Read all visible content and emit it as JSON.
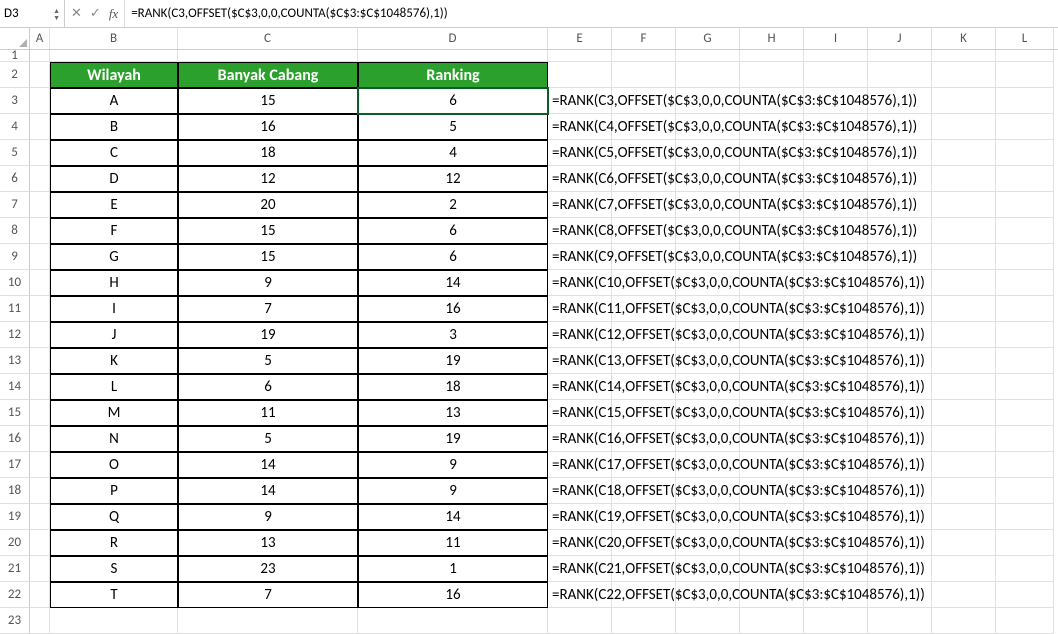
{
  "cell_reference": "D3",
  "formula": "=RANK(C3,OFFSET($C$3,0,0,COUNTA($C$3:$C$1048576),1))",
  "columns": [
    "A",
    "B",
    "C",
    "D",
    "E",
    "F",
    "G",
    "H",
    "I",
    "J",
    "K",
    "L"
  ],
  "table": {
    "headers": {
      "wilayah": "Wilayah",
      "banyak": "Banyak Cabang",
      "ranking": "Ranking"
    },
    "rows": [
      {
        "rownum": "3",
        "w": "A",
        "b": "15",
        "r": "6",
        "f": "=RANK(C3,OFFSET($C$3,0,0,COUNTA($C$3:$C$1048576),1))"
      },
      {
        "rownum": "4",
        "w": "B",
        "b": "16",
        "r": "5",
        "f": "=RANK(C4,OFFSET($C$3,0,0,COUNTA($C$3:$C$1048576),1))"
      },
      {
        "rownum": "5",
        "w": "C",
        "b": "18",
        "r": "4",
        "f": "=RANK(C5,OFFSET($C$3,0,0,COUNTA($C$3:$C$1048576),1))"
      },
      {
        "rownum": "6",
        "w": "D",
        "b": "12",
        "r": "12",
        "f": "=RANK(C6,OFFSET($C$3,0,0,COUNTA($C$3:$C$1048576),1))"
      },
      {
        "rownum": "7",
        "w": "E",
        "b": "20",
        "r": "2",
        "f": "=RANK(C7,OFFSET($C$3,0,0,COUNTA($C$3:$C$1048576),1))"
      },
      {
        "rownum": "8",
        "w": "F",
        "b": "15",
        "r": "6",
        "f": "=RANK(C8,OFFSET($C$3,0,0,COUNTA($C$3:$C$1048576),1))"
      },
      {
        "rownum": "9",
        "w": "G",
        "b": "15",
        "r": "6",
        "f": "=RANK(C9,OFFSET($C$3,0,0,COUNTA($C$3:$C$1048576),1))"
      },
      {
        "rownum": "10",
        "w": "H",
        "b": "9",
        "r": "14",
        "f": "=RANK(C10,OFFSET($C$3,0,0,COUNTA($C$3:$C$1048576),1))"
      },
      {
        "rownum": "11",
        "w": "I",
        "b": "7",
        "r": "16",
        "f": "=RANK(C11,OFFSET($C$3,0,0,COUNTA($C$3:$C$1048576),1))"
      },
      {
        "rownum": "12",
        "w": "J",
        "b": "19",
        "r": "3",
        "f": "=RANK(C12,OFFSET($C$3,0,0,COUNTA($C$3:$C$1048576),1))"
      },
      {
        "rownum": "13",
        "w": "K",
        "b": "5",
        "r": "19",
        "f": "=RANK(C13,OFFSET($C$3,0,0,COUNTA($C$3:$C$1048576),1))"
      },
      {
        "rownum": "14",
        "w": "L",
        "b": "6",
        "r": "18",
        "f": "=RANK(C14,OFFSET($C$3,0,0,COUNTA($C$3:$C$1048576),1))"
      },
      {
        "rownum": "15",
        "w": "M",
        "b": "11",
        "r": "13",
        "f": "=RANK(C15,OFFSET($C$3,0,0,COUNTA($C$3:$C$1048576),1))"
      },
      {
        "rownum": "16",
        "w": "N",
        "b": "5",
        "r": "19",
        "f": "=RANK(C16,OFFSET($C$3,0,0,COUNTA($C$3:$C$1048576),1))"
      },
      {
        "rownum": "17",
        "w": "O",
        "b": "14",
        "r": "9",
        "f": "=RANK(C17,OFFSET($C$3,0,0,COUNTA($C$3:$C$1048576),1))"
      },
      {
        "rownum": "18",
        "w": "P",
        "b": "14",
        "r": "9",
        "f": "=RANK(C18,OFFSET($C$3,0,0,COUNTA($C$3:$C$1048576),1))"
      },
      {
        "rownum": "19",
        "w": "Q",
        "b": "9",
        "r": "14",
        "f": "=RANK(C19,OFFSET($C$3,0,0,COUNTA($C$3:$C$1048576),1))"
      },
      {
        "rownum": "20",
        "w": "R",
        "b": "13",
        "r": "11",
        "f": "=RANK(C20,OFFSET($C$3,0,0,COUNTA($C$3:$C$1048576),1))"
      },
      {
        "rownum": "21",
        "w": "S",
        "b": "23",
        "r": "1",
        "f": "=RANK(C21,OFFSET($C$3,0,0,COUNTA($C$3:$C$1048576),1))"
      },
      {
        "rownum": "22",
        "w": "T",
        "b": "7",
        "r": "16",
        "f": "=RANK(C22,OFFSET($C$3,0,0,COUNTA($C$3:$C$1048576),1))"
      }
    ]
  },
  "trailing_rows": [
    "23"
  ],
  "accent_color": "#2ca02c"
}
